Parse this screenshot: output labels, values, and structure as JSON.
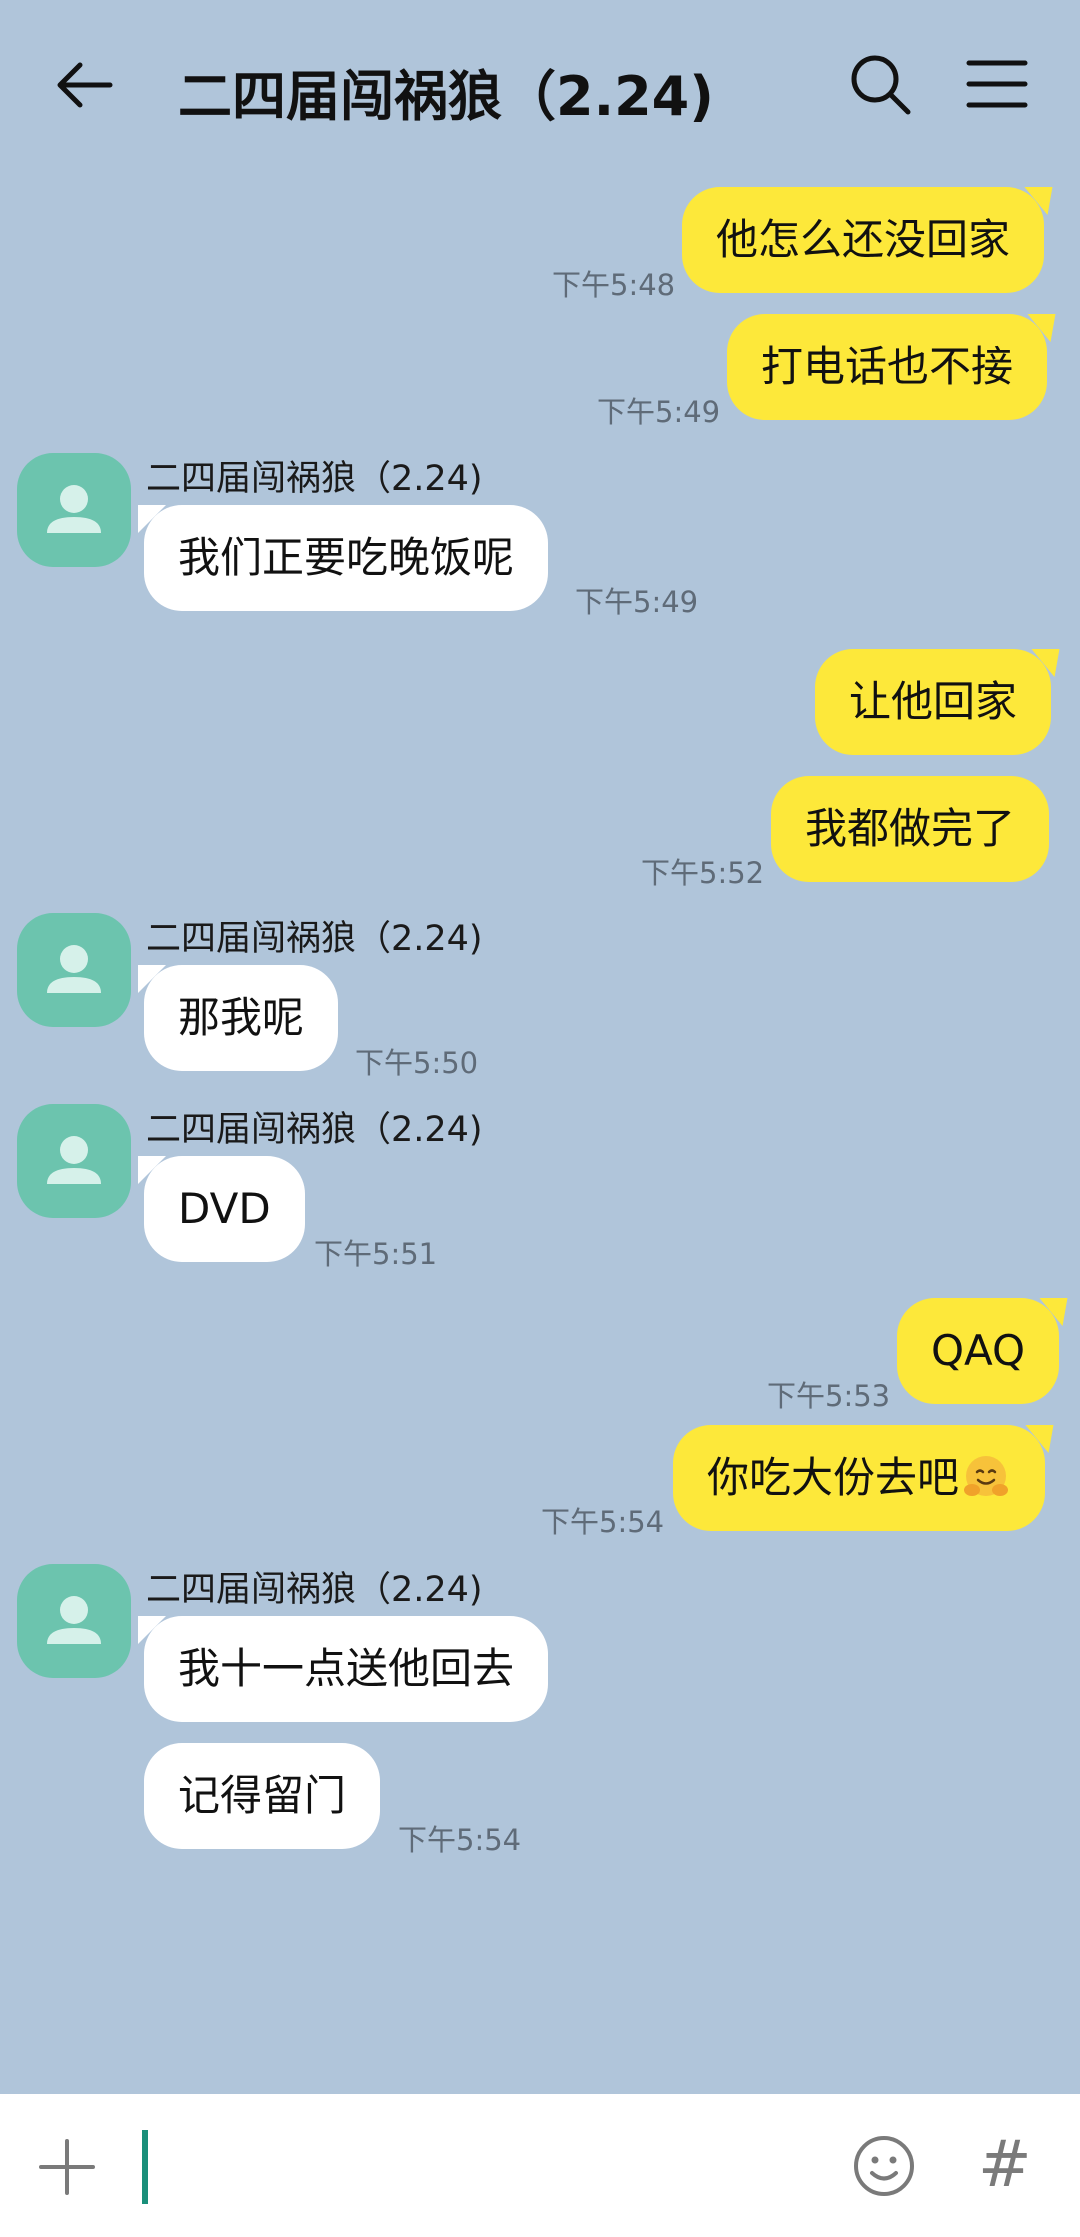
{
  "header": {
    "title": "二四届闯祸狼（2.24)",
    "back_icon": "back-arrow-icon",
    "search_icon": "search-icon",
    "menu_icon": "menu-icon"
  },
  "colors": {
    "background": "#b0c5da",
    "outgoing_bubble": "#fde83a",
    "incoming_bubble": "#ffffff",
    "avatar": "#6cc4ae",
    "caret": "#1a8f7a"
  },
  "messages": [
    {
      "direction": "out",
      "text": "他怎么还没回家",
      "time": "下午5:48"
    },
    {
      "direction": "out",
      "text": "打电话也不接",
      "time": "下午5:49"
    },
    {
      "direction": "in",
      "sender": "二四届闯祸狼（2.24)",
      "text": "我们正要吃晚饭呢",
      "time": "下午5:49"
    },
    {
      "direction": "out",
      "text": "让他回家",
      "time": ""
    },
    {
      "direction": "out",
      "text": "我都做完了",
      "time": "下午5:52"
    },
    {
      "direction": "in",
      "sender": "二四届闯祸狼（2.24)",
      "text": "那我呢",
      "time": "下午5:50"
    },
    {
      "direction": "in",
      "sender": "二四届闯祸狼（2.24)",
      "text": "DVD",
      "time": "下午5:51"
    },
    {
      "direction": "out",
      "text": "QAQ",
      "time": "下午5:53"
    },
    {
      "direction": "out",
      "text": "你吃大份去吧",
      "emoji": "hugging-face-emoji",
      "time": "下午5:54"
    },
    {
      "direction": "in",
      "sender": "二四届闯祸狼（2.24)",
      "text": "我十一点送他回去",
      "time": ""
    },
    {
      "direction": "in",
      "text": "记得留门",
      "time": "下午5:54"
    }
  ],
  "input_bar": {
    "placeholder": "",
    "value": "",
    "plus_icon": "plus-icon",
    "emoji_icon": "emoji-icon",
    "hash_label": "#"
  }
}
